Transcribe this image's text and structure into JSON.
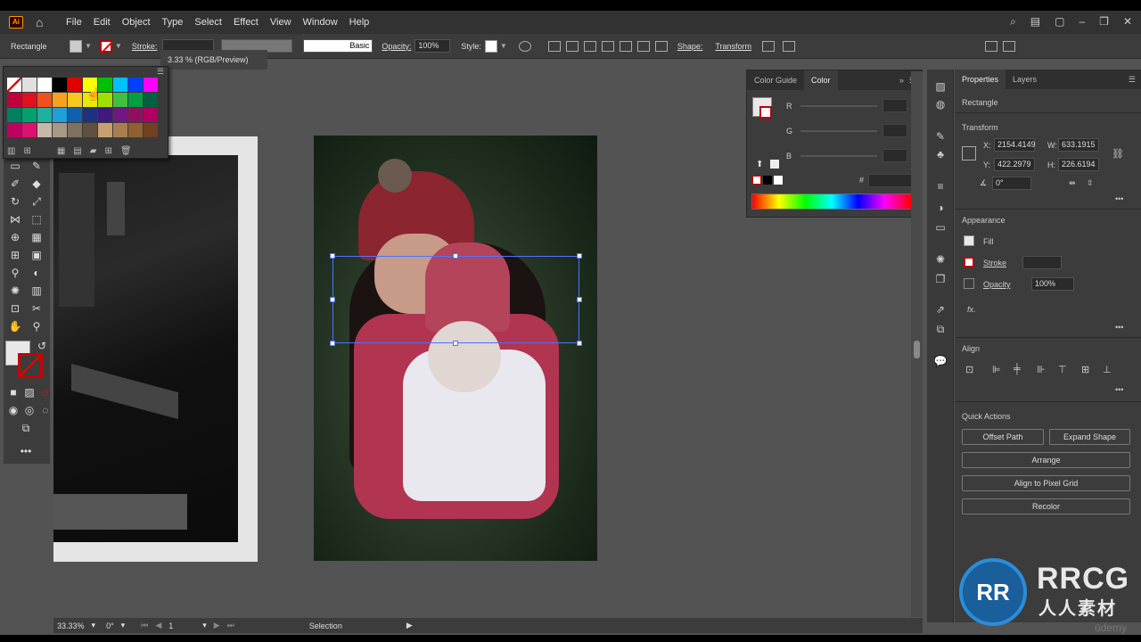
{
  "menubar": {
    "logo": "Ai",
    "items": [
      "File",
      "Edit",
      "Object",
      "Type",
      "Select",
      "Effect",
      "View",
      "Window",
      "Help"
    ]
  },
  "control": {
    "object": "Rectangle",
    "stroke_label": "Stroke:",
    "brush": "Basic",
    "opacity_label": "Opacity:",
    "opacity_value": "100%",
    "style_label": "Style:",
    "shape_label": "Shape:",
    "transform_label": "Transform"
  },
  "doc_tab": {
    "title": "3.33 % (RGB/Preview)"
  },
  "color_panel": {
    "tabs": [
      "Color Guide",
      "Color"
    ],
    "channels": [
      "R",
      "G",
      "B"
    ],
    "hex_symbol": "#"
  },
  "swatches": [
    "#fff",
    "#e0e0e0",
    "#fff",
    "#000",
    "#e10000",
    "#ffff00",
    "#00c000",
    "#00c0ff",
    "#0040ff",
    "#ff00ff",
    "#c0003c",
    "#e01020",
    "#f05020",
    "#f8a020",
    "#f8c820",
    "#e8e800",
    "#a0e000",
    "#40c040",
    "#00a040",
    "#006040",
    "#008060",
    "#00a070",
    "#20b0a0",
    "#20a0d8",
    "#1060b0",
    "#203080",
    "#401880",
    "#701880",
    "#901060",
    "#b00060",
    "#c00060",
    "#e01070",
    "#c8b8a8",
    "#a89888",
    "#807060",
    "#605040",
    "#c8a070",
    "#a88050",
    "#906030",
    "#704020"
  ],
  "properties": {
    "tabs": [
      "Properties",
      "Layers"
    ],
    "object": "Rectangle",
    "transform": {
      "label": "Transform",
      "x_label": "X:",
      "x": "2154.4149",
      "y_label": "Y:",
      "y": "422.2979",
      "w_label": "W:",
      "w": "633.1915",
      "h_label": "H:",
      "h": "226.6194",
      "angle": "0°"
    },
    "appearance": {
      "label": "Appearance",
      "fill": "Fill",
      "stroke": "Stroke",
      "opacity_label": "Opacity",
      "opacity": "100%",
      "fx": "fx."
    },
    "align_label": "Align",
    "quick_actions": {
      "label": "Quick Actions",
      "offset_path": "Offset Path",
      "expand_shape": "Expand Shape",
      "arrange": "Arrange",
      "align_pixel": "Align to Pixel Grid",
      "recolor": "Recolor"
    }
  },
  "status": {
    "zoom": "33.33%",
    "rotation": "0°",
    "artboard": "1",
    "tool": "Selection"
  },
  "watermark": {
    "logo": "RR",
    "brand": "RRCG",
    "sub": "人人素材",
    "udemy": "ūdemy"
  },
  "colors": {
    "accent_blue": "#4e74ff",
    "stroke_red": "#cc0000"
  }
}
